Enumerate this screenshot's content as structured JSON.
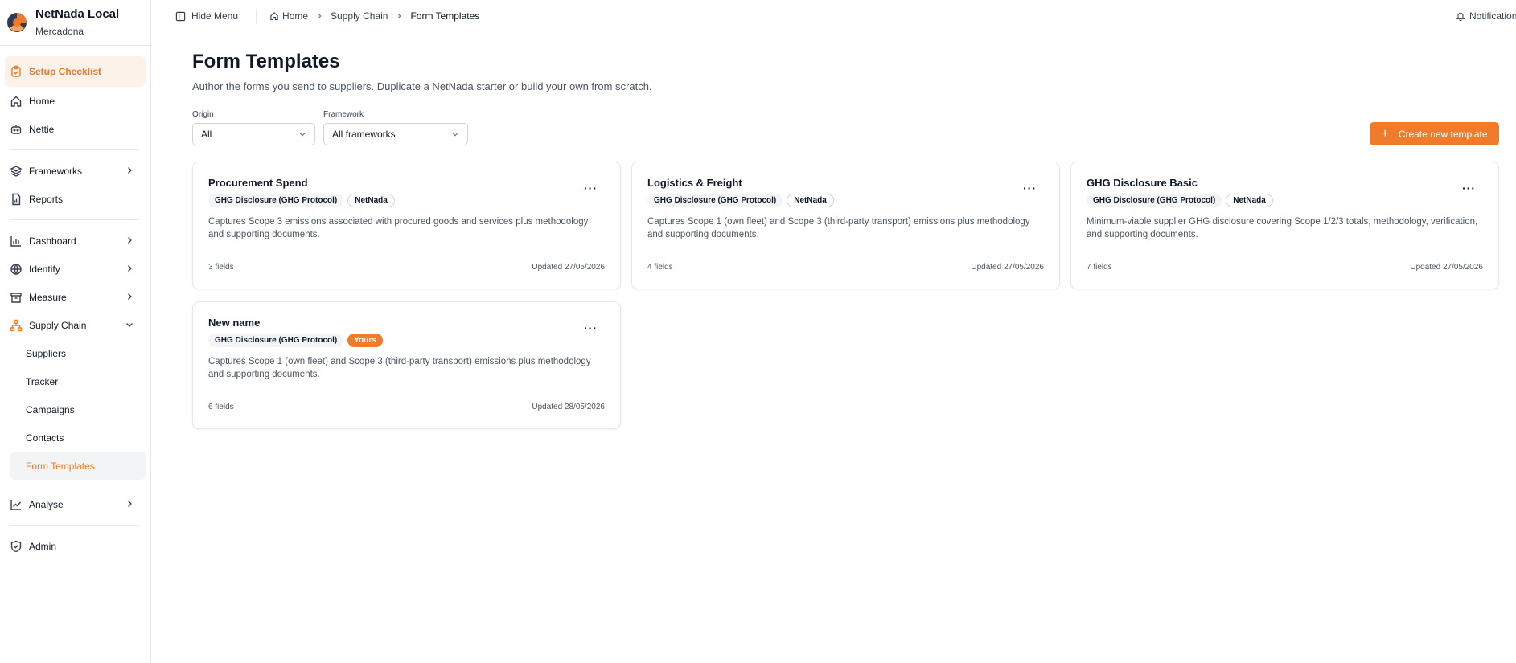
{
  "brand": {
    "name": "NetNada Local",
    "org": "Mercadona"
  },
  "nav": {
    "setup": "Setup Checklist",
    "home": "Home",
    "nettie": "Nettie",
    "frameworks": "Frameworks",
    "reports": "Reports",
    "dashboard": "Dashboard",
    "identify": "Identify",
    "measure": "Measure",
    "supply_chain": "Supply Chain",
    "sub": {
      "suppliers": "Suppliers",
      "tracker": "Tracker",
      "campaigns": "Campaigns",
      "contacts": "Contacts",
      "form_templates": "Form Templates"
    },
    "analyse": "Analyse",
    "admin": "Admin"
  },
  "topbar": {
    "hide_menu": "Hide Menu",
    "breadcrumb": [
      "Home",
      "Supply Chain",
      "Form Templates"
    ],
    "notifications": "Notifications"
  },
  "page": {
    "title": "Form Templates",
    "subtitle": "Author the forms you send to suppliers. Duplicate a NetNada starter or build your own from scratch."
  },
  "filters": {
    "origin_label": "Origin",
    "origin_value": "All",
    "framework_label": "Framework",
    "framework_value": "All frameworks"
  },
  "create_button": "Create new template",
  "cards": [
    {
      "title": "Procurement Spend",
      "framework": "GHG Disclosure (GHG Protocol)",
      "origin": "NetNada",
      "description": "Captures Scope 3 emissions associated with procured goods and services plus methodology and supporting documents.",
      "fields": "3 fields",
      "updated": "Updated 27/05/2026"
    },
    {
      "title": "Logistics & Freight",
      "framework": "GHG Disclosure (GHG Protocol)",
      "origin": "NetNada",
      "description": "Captures Scope 1 (own fleet) and Scope 3 (third-party transport) emissions plus methodology and supporting documents.",
      "fields": "4 fields",
      "updated": "Updated 27/05/2026"
    },
    {
      "title": "GHG Disclosure Basic",
      "framework": "GHG Disclosure (GHG Protocol)",
      "origin": "NetNada",
      "description": "Minimum-viable supplier GHG disclosure covering Scope 1/2/3 totals, methodology, verification, and supporting documents.",
      "fields": "7 fields",
      "updated": "Updated 27/05/2026"
    },
    {
      "title": "New name",
      "framework": "GHG Disclosure (GHG Protocol)",
      "origin": "Yours",
      "description": "Captures Scope 1 (own fleet) and Scope 3 (third-party transport) emissions plus methodology and supporting documents.",
      "fields": "6 fields",
      "updated": "Updated 28/05/2026"
    }
  ],
  "colors": {
    "accent": "#ef7b2b",
    "accent_soft": "#fdf2ea",
    "border": "#e5e7eb"
  }
}
